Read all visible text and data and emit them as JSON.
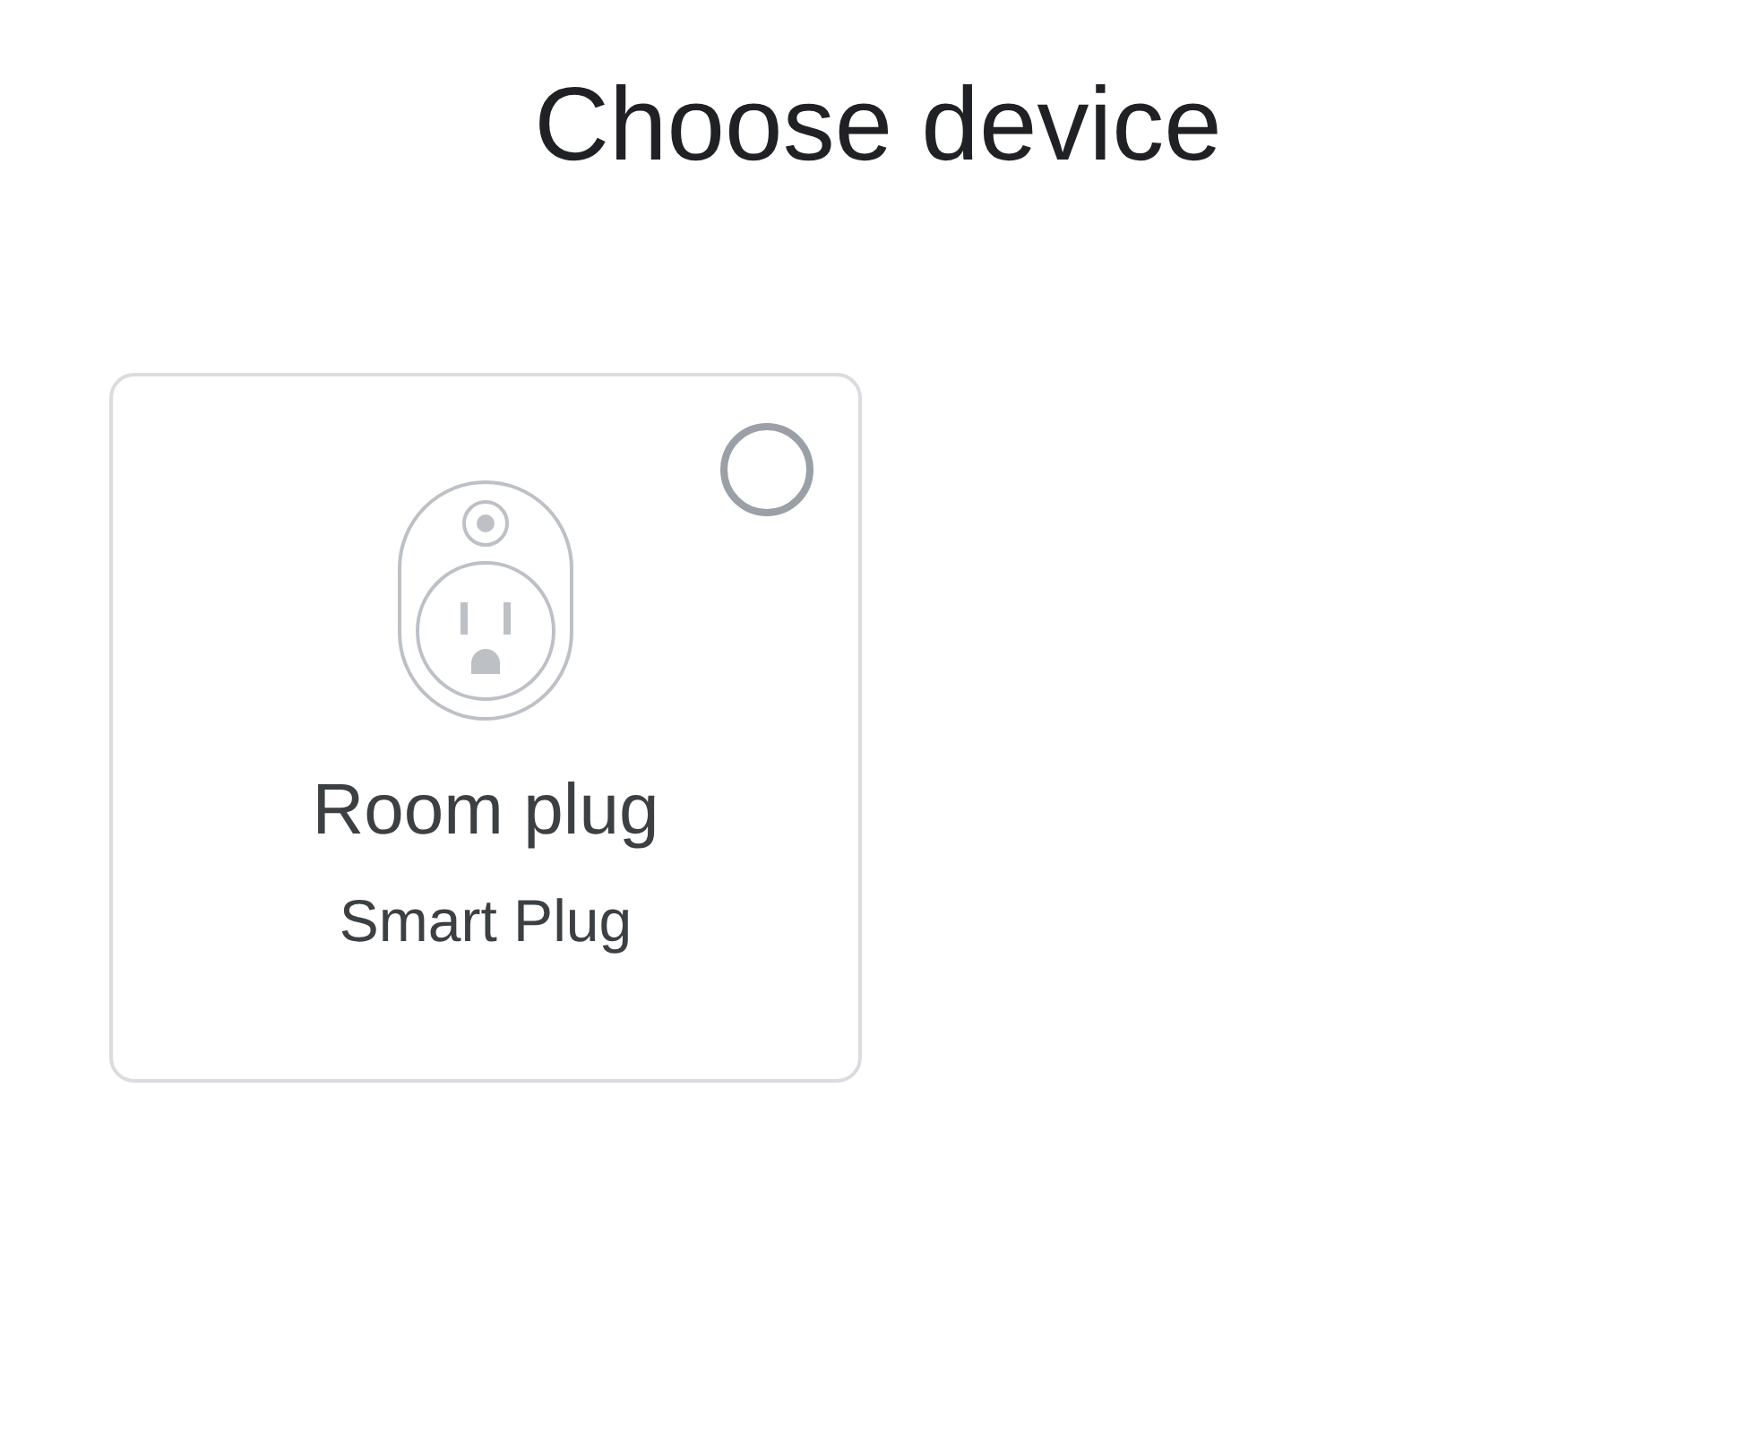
{
  "title": "Choose device",
  "devices": [
    {
      "name": "Room plug",
      "type": "Smart Plug",
      "selected": false
    }
  ]
}
